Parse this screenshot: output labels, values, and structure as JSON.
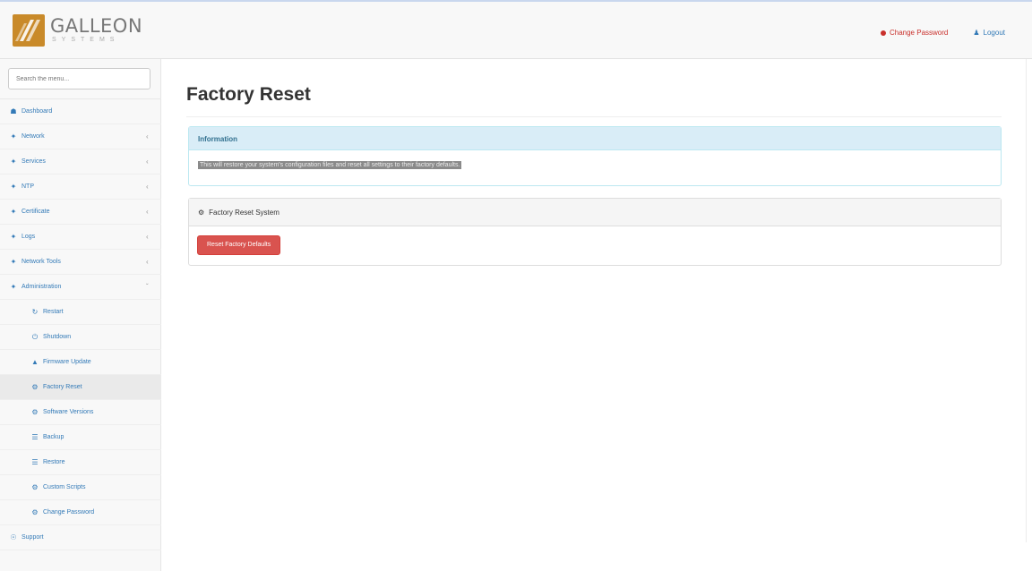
{
  "header": {
    "brand_name": "GALLEON",
    "brand_sub": "SYSTEMS",
    "change_password_label": "Change Password",
    "logout_label": "Logout",
    "accent_color": "#c9302c"
  },
  "sidebar": {
    "search_placeholder": "Search the menu...",
    "items": [
      {
        "icon": "dashboard-icon",
        "label": "Dashboard",
        "has_chevron": false
      },
      {
        "icon": "wrench-icon",
        "label": "Network",
        "has_chevron": true
      },
      {
        "icon": "wrench-icon",
        "label": "Services",
        "has_chevron": true
      },
      {
        "icon": "wrench-icon",
        "label": "NTP",
        "has_chevron": true
      },
      {
        "icon": "wrench-icon",
        "label": "Certificate",
        "has_chevron": true
      },
      {
        "icon": "wrench-icon",
        "label": "Logs",
        "has_chevron": true
      },
      {
        "icon": "wrench-icon",
        "label": "Network Tools",
        "has_chevron": true
      },
      {
        "icon": "wrench-icon",
        "label": "Administration",
        "has_chevron": true,
        "expanded": true
      }
    ],
    "subitems": [
      {
        "icon": "refresh-icon",
        "label": "Restart"
      },
      {
        "icon": "power-icon",
        "label": "Shutdown"
      },
      {
        "icon": "upload-icon",
        "label": "Firmware Update"
      },
      {
        "icon": "gear-icon",
        "label": "Factory Reset",
        "active": true
      },
      {
        "icon": "gear-icon",
        "label": "Software Versions"
      },
      {
        "icon": "database-icon",
        "label": "Backup"
      },
      {
        "icon": "database-icon",
        "label": "Restore"
      },
      {
        "icon": "gear-icon",
        "label": "Custom Scripts"
      },
      {
        "icon": "gear-icon",
        "label": "Change Password"
      }
    ],
    "footer_item": {
      "icon": "support-icon",
      "label": "Support"
    }
  },
  "main": {
    "title": "Factory Reset",
    "info_panel": {
      "heading": "Information",
      "body": "This will restore your system's configuration files and reset all settings to their factory defaults."
    },
    "reset_panel": {
      "heading": "Factory Reset System",
      "button_label": "Reset Factory Defaults",
      "button_color": "#d9534f"
    }
  }
}
